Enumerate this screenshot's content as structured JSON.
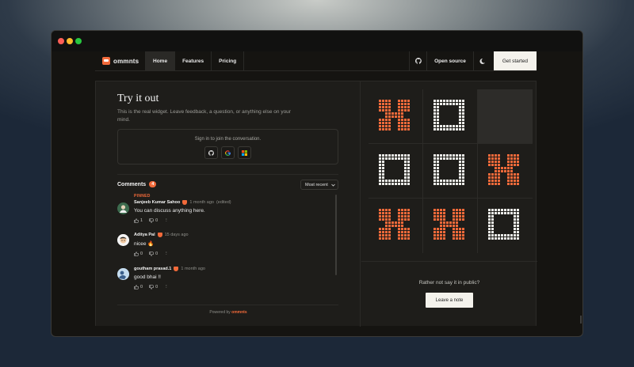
{
  "navbar": {
    "brand": "ommnts",
    "links": [
      "Home",
      "Features",
      "Pricing"
    ],
    "active": "Home",
    "open_source": "Open source",
    "cta": "Get started"
  },
  "widget": {
    "title": "Try it out",
    "subtitle": "This is the real widget. Leave feedback, a question, or anything else on your mind.",
    "signin_text": "Sign in to join the conversation.",
    "providers": [
      "github-icon",
      "google-icon",
      "microsoft-icon"
    ],
    "comments_label": "Comments",
    "comments_count": "4",
    "sort_label": "Most recent",
    "comments": [
      {
        "pinned": "PINNED",
        "author": "Sanjeeb Kumar Sahoo",
        "time": "1 month ago",
        "edited": "(edited)",
        "text": "You can discuss anything here.",
        "likes": "1",
        "dislikes": "0"
      },
      {
        "author": "Aditya Pal",
        "time": "15 days ago",
        "text": "nicee 🔥",
        "likes": "0",
        "dislikes": "0"
      },
      {
        "author": "goutham prasad.1",
        "time": "1 month ago",
        "text": "good bhai !!",
        "likes": "0",
        "dislikes": "0"
      }
    ],
    "powered_prefix": "Powered by",
    "powered_brand": "ommnts"
  },
  "game": {
    "board": [
      "X",
      "O",
      "",
      "O",
      "O",
      "X",
      "X",
      "X",
      "O"
    ],
    "highlight_index": 2,
    "question": "Rather not say it in public?",
    "button": "Leave a note"
  },
  "colors": {
    "accent": "#f26a3a",
    "tile_o": "#eeeeea"
  }
}
